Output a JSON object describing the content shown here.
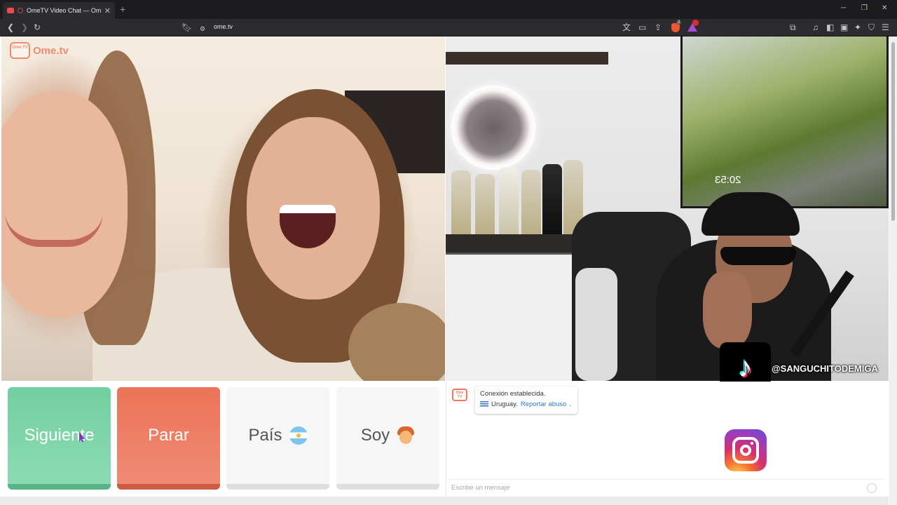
{
  "browser": {
    "tab_title": "OmeTV Video Chat — Omeg",
    "tab_close": "✕",
    "new_tab": "+",
    "url": "ome.tv",
    "minimize": "─",
    "restore": "❐",
    "close": "✕",
    "shield_badge": "2"
  },
  "logo": {
    "box_text": "Ome TV",
    "text": "Ome.tv"
  },
  "stranger_video": {
    "clock": "20:53"
  },
  "overlay": {
    "tiktok_handle": "@SANGUCHITODEMIGA"
  },
  "controls": {
    "next_label": "Siguiente",
    "stop_label": "Parar",
    "country_label": "País",
    "gender_label": "Soy"
  },
  "chat": {
    "avatar_text": "Ome TV",
    "status_message": "Conexión establecida.",
    "country": "Uruguay.",
    "report_link": "Reportar abuso",
    "input_placeholder": "Escribe un mensaje"
  },
  "colors": {
    "next_button": "#72cfa0",
    "stop_button": "#ec7358",
    "brand": "#f08c6e",
    "link": "#2e77c8"
  },
  "icons": {
    "back": "chevron-left-icon",
    "forward": "chevron-right-icon",
    "reload": "reload-icon",
    "bookmark": "bookmark-icon",
    "translate": "translate-icon",
    "cast": "cast-icon",
    "share": "share-icon",
    "brave_shields": "brave-shield-icon",
    "rewards": "brave-rewards-icon",
    "music": "music-icon",
    "sidebar": "sidebar-icon",
    "wallet": "wallet-icon",
    "leo": "ai-sparkle-icon",
    "vpn": "vpn-shield-icon",
    "menu": "hamburger-menu-icon",
    "emoji": "smiley-icon"
  }
}
